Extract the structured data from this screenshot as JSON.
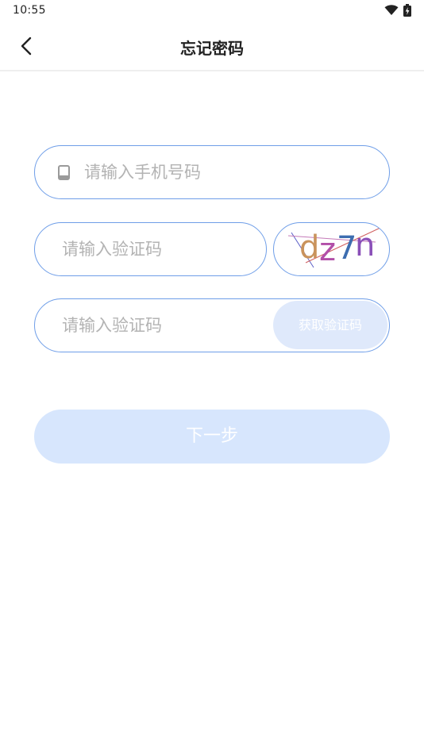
{
  "status_bar": {
    "time": "10:55",
    "icons": [
      "wifi-icon",
      "battery-charging-icon"
    ]
  },
  "header": {
    "title": "忘记密码",
    "back_icon": "chevron-left-icon"
  },
  "form": {
    "phone": {
      "icon": "phone-icon",
      "placeholder": "请输入手机号码",
      "value": ""
    },
    "captcha": {
      "placeholder": "请输入验证码",
      "value": "",
      "image_text": [
        "d",
        "z",
        "7",
        "n"
      ]
    },
    "sms": {
      "placeholder": "请输入验证码",
      "value": "",
      "button_label": "获取验证码"
    },
    "next_button_label": "下一步"
  },
  "colors": {
    "field_border": "#6f9ee8",
    "button_disabled": "#d7e6fd",
    "placeholder": "#b3b3b3"
  }
}
